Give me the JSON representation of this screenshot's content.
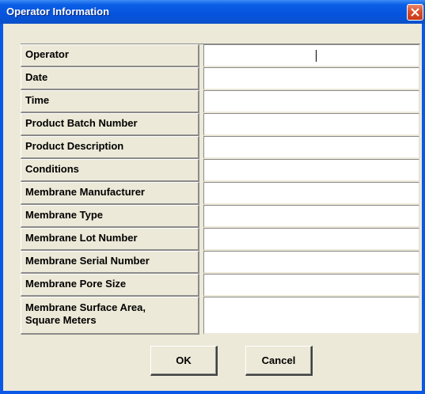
{
  "window": {
    "title": "Operator Information",
    "close_icon": "close-icon"
  },
  "fields": [
    {
      "label": "Operator",
      "value": ""
    },
    {
      "label": "Date",
      "value": ""
    },
    {
      "label": "Time",
      "value": ""
    },
    {
      "label": "Product Batch Number",
      "value": ""
    },
    {
      "label": "Product Description",
      "value": ""
    },
    {
      "label": "Conditions",
      "value": ""
    },
    {
      "label": "Membrane Manufacturer",
      "value": ""
    },
    {
      "label": "Membrane Type",
      "value": ""
    },
    {
      "label": "Membrane Lot Number",
      "value": ""
    },
    {
      "label": "Membrane Serial Number",
      "value": ""
    },
    {
      "label": "Membrane Pore Size",
      "value": ""
    },
    {
      "label": "Membrane Surface Area,\nSquare Meters",
      "value": ""
    }
  ],
  "buttons": {
    "ok_label": "OK",
    "cancel_label": "Cancel"
  },
  "colors": {
    "titlebar": "#0a58e8",
    "dialog_background": "#ece9d8",
    "close_button": "#dc4f2a"
  }
}
